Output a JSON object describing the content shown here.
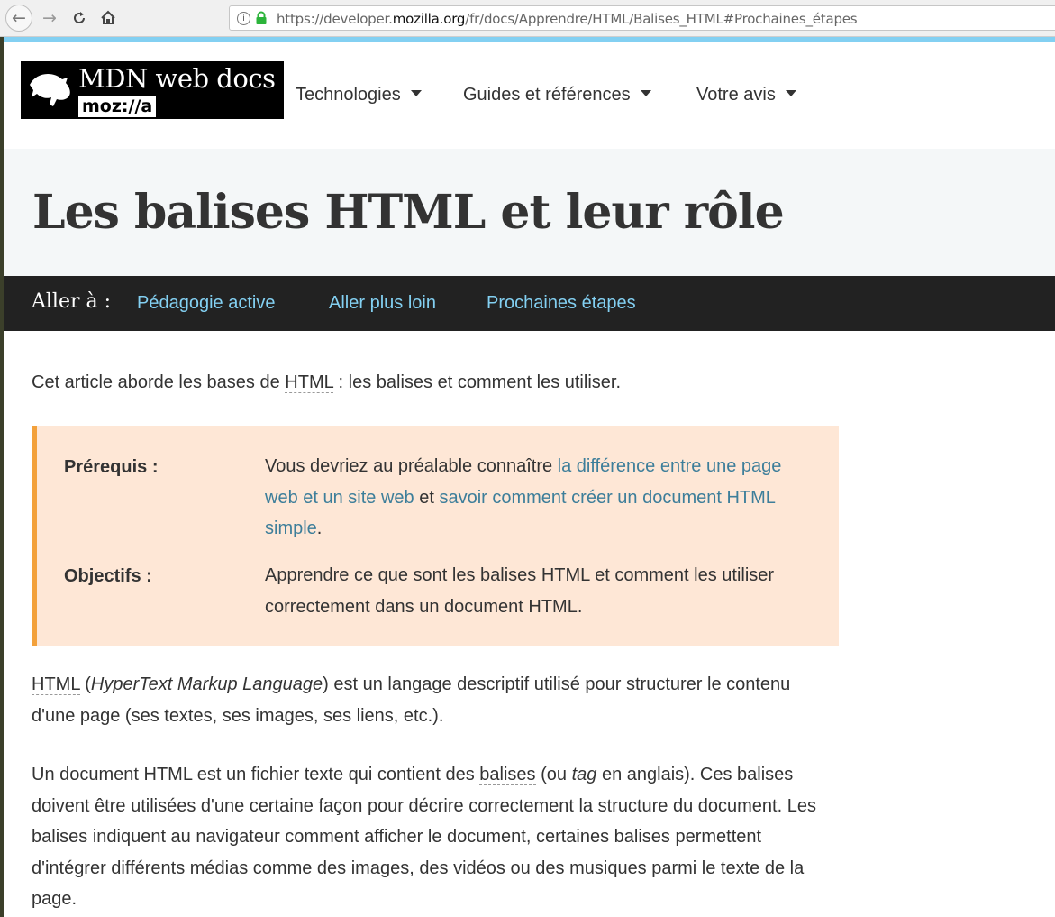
{
  "browser": {
    "url_prefix": "https://developer.",
    "url_domain": "mozilla.org",
    "url_path": "/fr/docs/Apprendre/HTML/Balises_HTML#Prochaines_étapes"
  },
  "header": {
    "logo_title": "MDN web docs",
    "logo_sub": "moz://a",
    "nav": [
      "Technologies",
      "Guides et références",
      "Votre avis"
    ]
  },
  "page": {
    "title": "Les balises HTML et leur rôle"
  },
  "jumpbar": {
    "label": "Aller à :",
    "links": [
      "Pédagogie active",
      "Aller plus loin",
      "Prochaines étapes"
    ]
  },
  "intro": {
    "before": "Cet article aborde les bases de ",
    "abbr": "HTML",
    "after": " : les balises et comment les utiliser."
  },
  "prereq": {
    "label": "Prérequis :",
    "text_1": "Vous devriez au préalable connaître ",
    "link_1": "la différence entre une page web et un site web",
    "text_2": " et ",
    "link_2": "savoir comment créer un document HTML simple",
    "text_3": "."
  },
  "objectives": {
    "label": "Objectifs :",
    "text": "Apprendre ce que sont les balises HTML et comment les utiliser correctement dans un document HTML."
  },
  "para1": {
    "abbr": "HTML",
    "open": " (",
    "italic": "HyperText Markup Language",
    "rest": ") est un langage descriptif utilisé pour structurer le contenu d'une page (ses textes, ses images, ses liens, etc.)."
  },
  "para2": {
    "text_1": "Un document HTML est un fichier texte qui contient des ",
    "abbr": "balises",
    "text_2": " (ou ",
    "italic": "tag",
    "text_3": " en anglais). Ces balises doivent être utilisées d'une certaine façon pour décrire correctement la structure du document. Les balises indiquent au navigateur comment afficher le document, certaines balises permettent d'intégrer différents médias comme des images, des vidéos ou des musiques parmi le texte de la page."
  },
  "colors": {
    "accent": "#83d0f2",
    "link": "#3d7e9a",
    "note_bg": "#fee7d6",
    "note_border": "#f3a13b"
  }
}
